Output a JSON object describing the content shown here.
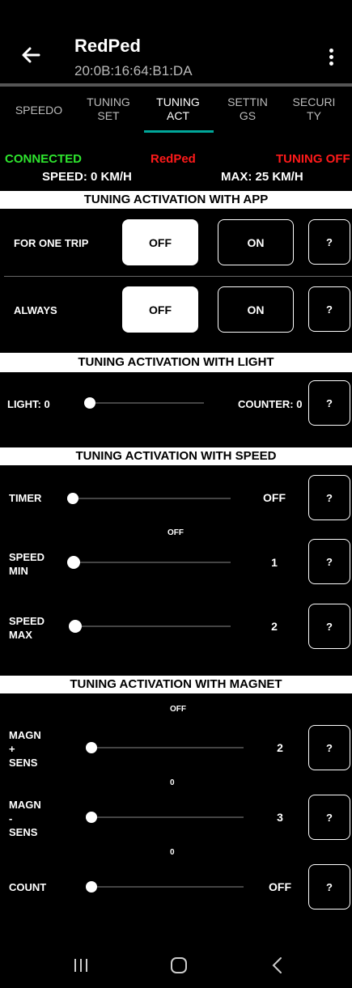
{
  "app": {
    "title": "RedPed",
    "subtitle": "20:0B:16:64:B1:DA"
  },
  "tabs": [
    {
      "label": "SPEEDO"
    },
    {
      "label": "TUNING\nSET"
    },
    {
      "label": "TUNING\nACT"
    },
    {
      "label": "SETTIN\nGS"
    },
    {
      "label": "SECURI\nTY"
    }
  ],
  "status": {
    "connected": "CONNECTED",
    "device": "RedPed",
    "tuning": "TUNING OFF",
    "speed": "SPEED: 0 KM/H",
    "max": "MAX: 25 KM/H",
    "colors": {
      "connected": "#2ee52e",
      "red": "#ff1a1a"
    }
  },
  "app_section": {
    "title": "TUNING ACTIVATION WITH APP",
    "rows": [
      {
        "label": "FOR ONE TRIP",
        "off": "OFF",
        "on": "ON",
        "help": "?",
        "selected": "off"
      },
      {
        "label": "ALWAYS",
        "off": "OFF",
        "on": "ON",
        "help": "?",
        "selected": "off"
      }
    ]
  },
  "light_section": {
    "title": "TUNING ACTIVATION WITH LIGHT",
    "light_label": "LIGHT: 0",
    "counter_label": "COUNTER: 0",
    "help": "?",
    "slider_value": 0
  },
  "speed_section": {
    "title": "TUNING ACTIVATION WITH SPEED",
    "timer": {
      "label": "TIMER",
      "value": "OFF",
      "help": "?"
    },
    "timer_state": "OFF",
    "speed_min": {
      "label": "SPEED\nMIN",
      "value": "1",
      "help": "?"
    },
    "speed_max": {
      "label": "SPEED\nMAX",
      "value": "2",
      "help": "?"
    }
  },
  "magnet_section": {
    "title": "TUNING ACTIVATION WITH MAGNET",
    "top_state": "OFF",
    "magn_plus": {
      "label": "MAGN\n+\nSENS",
      "value": "2",
      "help": "?",
      "below": "0"
    },
    "magn_minus": {
      "label": "MAGN\n-\nSENS",
      "value": "3",
      "help": "?",
      "below": "0"
    },
    "count": {
      "label": "COUNT",
      "value": "OFF",
      "help": "?"
    }
  }
}
